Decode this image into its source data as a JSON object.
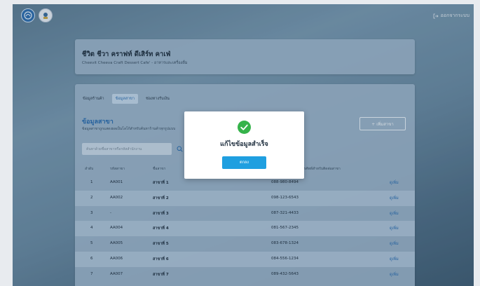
{
  "header": {
    "logout_label": "ออกจากระบบ"
  },
  "shop": {
    "name": "ชีวิต ชีวา คราฟท์ ดีเสิร์ท คาเฟ่",
    "subtitle": "Cheevit Cheeva Craft Dessert Cafe' - อาหารและเครื่องดื่ม"
  },
  "tabs": [
    {
      "label": "ข้อมูลร้านค้า",
      "active": false
    },
    {
      "label": "ข้อมูลสาขา",
      "active": true
    },
    {
      "label": "ช่องทางรับเงิน",
      "active": false
    }
  ],
  "section": {
    "title": "ข้อมูลสาขา",
    "subtitle": "ข้อมูลสาขาถูกแสดงผลเป็นโลโก้สำหรับค้นหาร้านค้าทุกรูปแบบ",
    "add_button": "+ เพิ่มสาขา",
    "search_placeholder": "ค้นหาด้วยชื่อสาขาหรือรหัสสำนักงาน"
  },
  "table": {
    "headers": [
      "ลำดับ",
      "รหัสสาขา",
      "ชื่อสาขา",
      "เบอร์โทรศัพท์สำหรับติดต่อสาขา"
    ],
    "rows": [
      {
        "no": "1",
        "code": "AA001",
        "name": "สาขาที่ 1",
        "phone": "088-980-8494",
        "action": "ดูเพิ่ม"
      },
      {
        "no": "2",
        "code": "AA002",
        "name": "สาขาที่ 2",
        "phone": "098-123-6543",
        "action": "ดูเพิ่ม"
      },
      {
        "no": "3",
        "code": "-",
        "name": "สาขาที่ 3",
        "phone": "087-321-4433",
        "action": "ดูเพิ่ม"
      },
      {
        "no": "4",
        "code": "AA004",
        "name": "สาขาที่ 4",
        "phone": "081-567-2345",
        "action": "ดูเพิ่ม"
      },
      {
        "no": "5",
        "code": "AA005",
        "name": "สาขาที่ 5",
        "phone": "083-678-1324",
        "action": "ดูเพิ่ม"
      },
      {
        "no": "6",
        "code": "AA006",
        "name": "สาขาที่ 6",
        "phone": "084-556-1234",
        "action": "ดูเพิ่ม"
      },
      {
        "no": "7",
        "code": "AA007",
        "name": "สาขาที่ 7",
        "phone": "089-432-5643",
        "action": "ดูเพิ่ม"
      }
    ]
  },
  "modal": {
    "icon": "check-circle-icon",
    "title": "แก้ไขข้อมูลสำเร็จ",
    "button": "ตกลง"
  },
  "colors": {
    "accent": "#1f9fe0",
    "success": "#35b34a",
    "link": "#2a6db0"
  }
}
